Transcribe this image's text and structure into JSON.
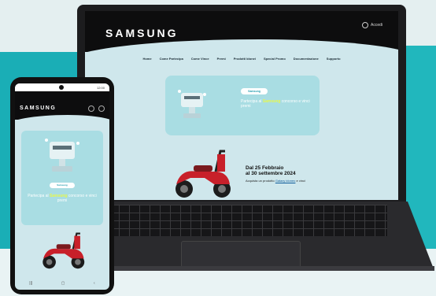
{
  "laptop": {
    "brand": "SAMSUNG",
    "account_label": "Accedi",
    "nav_items": [
      "Home",
      "Come Partecipa",
      "Come Vince",
      "Premi",
      "Prodotti Idonei",
      "Special Promo",
      "Documentazione",
      "Supporto"
    ],
    "banner": {
      "badge": "Samsung",
      "headline": "Partecipa al",
      "headline_highlight": "Samsung",
      "headline_tail": "concorso e vinci premi"
    },
    "promo": {
      "title_line1": "Dal 25 Febbraio",
      "title_line2": "al 30 settembre 2024",
      "subtitle_pre": "Acquista un prodotto",
      "subtitle_link": "Galaxy idoneo",
      "subtitle_post": "e vinci"
    }
  },
  "phone": {
    "brand": "SAMSUNG",
    "clock": "12:00",
    "banner": {
      "badge": "Samsung",
      "headline": "Partecipa al",
      "headline_highlight": "Samsung",
      "headline_tail": "concorso e vinci premi"
    },
    "nav_icons": [
      "menu-icon",
      "home-icon",
      "back-icon"
    ],
    "nav_glyphs": [
      "|||",
      "▢",
      "‹"
    ]
  },
  "colors": {
    "teal_background": "#1aaeb6",
    "banner": "#a9dde3",
    "highlight": "#e8f84a",
    "scooter_red": "#c8202a"
  }
}
